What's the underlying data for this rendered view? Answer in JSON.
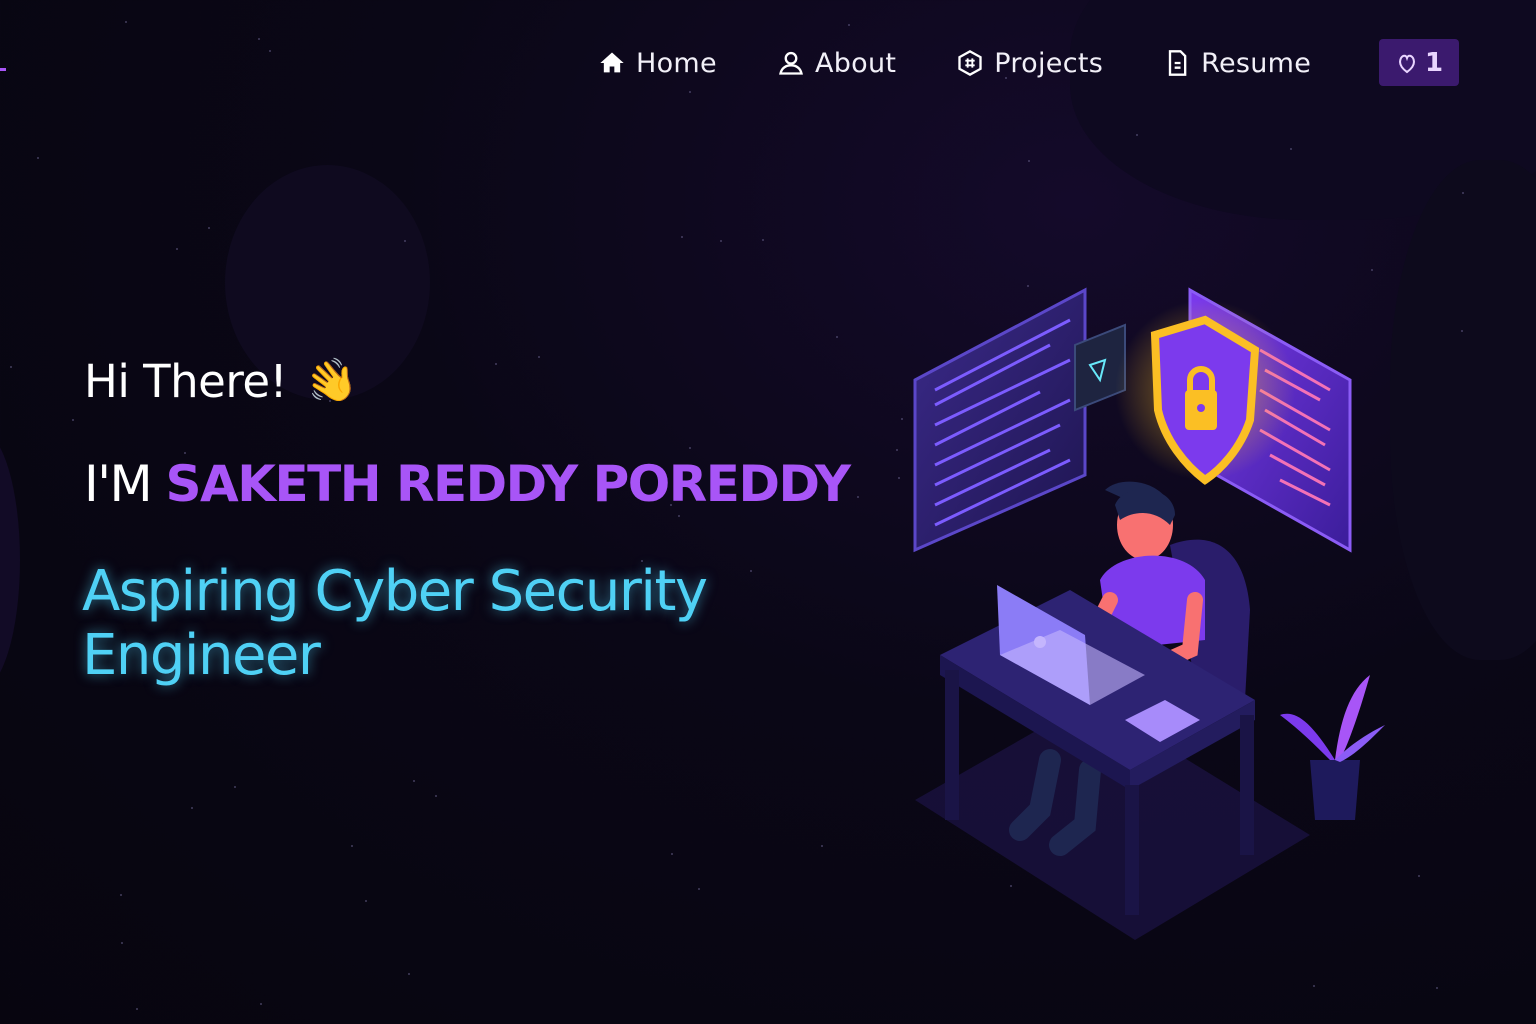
{
  "nav": {
    "items": [
      {
        "label": "Home",
        "icon": "home-icon"
      },
      {
        "label": "About",
        "icon": "user-icon"
      },
      {
        "label": "Projects",
        "icon": "projects-icon"
      },
      {
        "label": "Resume",
        "icon": "resume-icon"
      }
    ],
    "fork": {
      "count": "1",
      "icon": "fork-icon"
    }
  },
  "hero": {
    "greeting": "Hi There!",
    "wave_emoji": "👋",
    "intro_prefix": "I'M",
    "name": "SAKETH REDDY POREDDY",
    "role": "Aspiring Cyber Security Engineer"
  },
  "colors": {
    "accent": "#a855f7",
    "role": "#4fd1f5",
    "background": "#0a0716",
    "fork_button": "#3b1a6e"
  }
}
